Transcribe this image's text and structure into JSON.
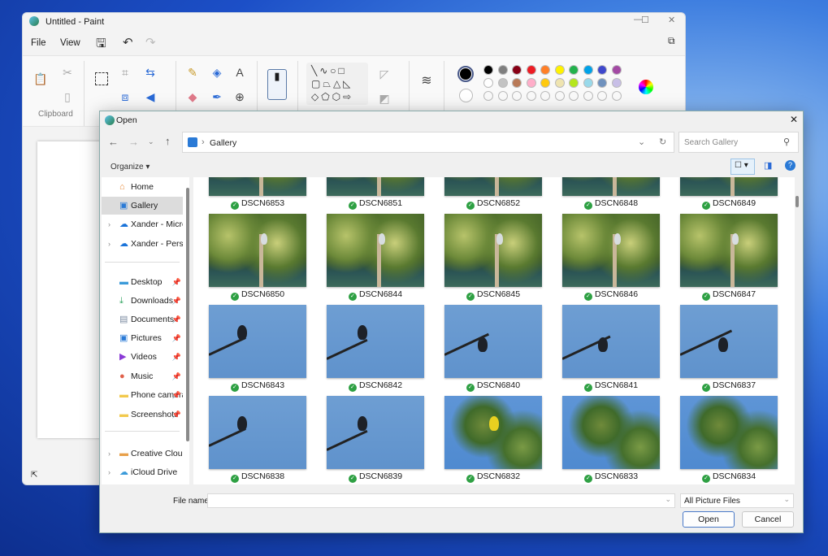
{
  "paint": {
    "title": "Untitled - Paint",
    "menu": [
      "File",
      "View"
    ],
    "clipboard_label": "Clipboard",
    "palette_row1": [
      "#000000",
      "#7f7f7f",
      "#880015",
      "#ed1c24",
      "#ff7f27",
      "#fff200",
      "#22b14c",
      "#00a2e8",
      "#3f48cc",
      "#a349a4"
    ],
    "palette_row2": [
      "#ffffff",
      "#c3c3c3",
      "#b97a57",
      "#ffaec9",
      "#ffc90e",
      "#efe4b0",
      "#b5e61d",
      "#99d9ea",
      "#7092be",
      "#c8bfe7"
    ],
    "primary_color": "#000000",
    "secondary_color": "#ffffff"
  },
  "dialog": {
    "title": "Open",
    "address": "Gallery",
    "search_placeholder": "Search Gallery",
    "organize": "Organize",
    "sidebar": [
      {
        "label": "Home",
        "icon": "home-icon",
        "glyph": "⌂",
        "color": "#e88a3a",
        "selected": false,
        "chevron": false,
        "pin": false
      },
      {
        "label": "Gallery",
        "icon": "gallery-icon",
        "glyph": "▣",
        "color": "#2a7ad6",
        "selected": true,
        "chevron": false,
        "pin": false
      },
      {
        "label": "Xander - Microsoft",
        "icon": "onedrive-icon",
        "glyph": "☁",
        "color": "#1a73d9",
        "selected": false,
        "chevron": true,
        "pin": false
      },
      {
        "label": "Xander - Personal",
        "icon": "onedrive-icon",
        "glyph": "☁",
        "color": "#1a73d9",
        "selected": false,
        "chevron": true,
        "pin": false
      },
      {
        "label": "Desktop",
        "icon": "desktop-icon",
        "glyph": "▬",
        "color": "#3a9ad9",
        "selected": false,
        "chevron": false,
        "pin": true
      },
      {
        "label": "Downloads",
        "icon": "downloads-icon",
        "glyph": "⤓",
        "color": "#2aa05a",
        "selected": false,
        "chevron": false,
        "pin": true
      },
      {
        "label": "Documents",
        "icon": "documents-icon",
        "glyph": "▤",
        "color": "#7a8aa0",
        "selected": false,
        "chevron": false,
        "pin": true
      },
      {
        "label": "Pictures",
        "icon": "pictures-icon",
        "glyph": "▣",
        "color": "#2a7ad6",
        "selected": false,
        "chevron": false,
        "pin": true
      },
      {
        "label": "Videos",
        "icon": "videos-icon",
        "glyph": "▶",
        "color": "#8a3ad6",
        "selected": false,
        "chevron": false,
        "pin": true
      },
      {
        "label": "Music",
        "icon": "music-icon",
        "glyph": "●",
        "color": "#e0604a",
        "selected": false,
        "chevron": false,
        "pin": true
      },
      {
        "label": "Phone camera",
        "icon": "folder-icon",
        "glyph": "▬",
        "color": "#f2c94c",
        "selected": false,
        "chevron": false,
        "pin": true
      },
      {
        "label": "Screenshots",
        "icon": "folder-icon",
        "glyph": "▬",
        "color": "#f2c94c",
        "selected": false,
        "chevron": false,
        "pin": true
      },
      {
        "label": "Creative Cloud Files",
        "icon": "creative-cloud-icon",
        "glyph": "▬",
        "color": "#e8a04a",
        "selected": false,
        "chevron": true,
        "pin": false
      },
      {
        "label": "iCloud Drive",
        "icon": "icloud-icon",
        "glyph": "☁",
        "color": "#3a9ad9",
        "selected": false,
        "chevron": true,
        "pin": false
      }
    ],
    "files": [
      {
        "name": "DSCN6853",
        "kind": "forest"
      },
      {
        "name": "DSCN6851",
        "kind": "forest"
      },
      {
        "name": "DSCN6852",
        "kind": "forest"
      },
      {
        "name": "DSCN6848",
        "kind": "forest"
      },
      {
        "name": "DSCN6849",
        "kind": "forest"
      },
      {
        "name": "DSCN6850",
        "kind": "forest"
      },
      {
        "name": "DSCN6844",
        "kind": "forest"
      },
      {
        "name": "DSCN6845",
        "kind": "forest"
      },
      {
        "name": "DSCN6846",
        "kind": "forest"
      },
      {
        "name": "DSCN6847",
        "kind": "forest"
      },
      {
        "name": "DSCN6843",
        "kind": "sky"
      },
      {
        "name": "DSCN6842",
        "kind": "sky"
      },
      {
        "name": "DSCN6840",
        "kind": "sky"
      },
      {
        "name": "DSCN6841",
        "kind": "sky"
      },
      {
        "name": "DSCN6837",
        "kind": "sky"
      },
      {
        "name": "DSCN6838",
        "kind": "sky"
      },
      {
        "name": "DSCN6839",
        "kind": "sky"
      },
      {
        "name": "DSCN6832",
        "kind": "tree"
      },
      {
        "name": "DSCN6833",
        "kind": "tree"
      },
      {
        "name": "DSCN6834",
        "kind": "tree"
      }
    ],
    "file_name_label": "File name:",
    "file_name_value": "",
    "file_type": "All Picture Files",
    "open": "Open",
    "cancel": "Cancel"
  }
}
